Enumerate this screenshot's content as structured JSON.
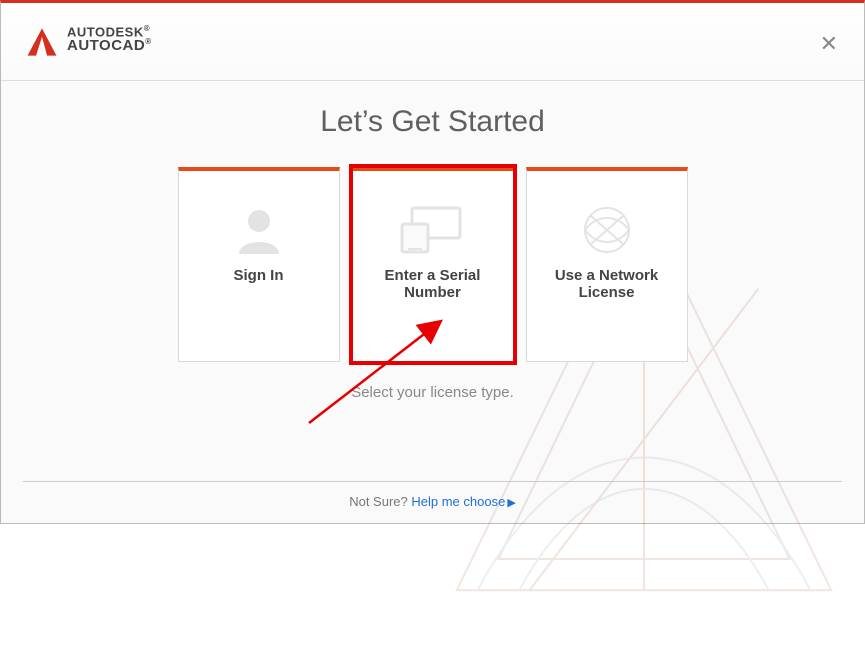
{
  "brand": {
    "line1": "AUTODESK",
    "line2": "AUTOCAD"
  },
  "title": "Let’s Get Started",
  "cards": {
    "signin": {
      "label": "Sign In"
    },
    "serial": {
      "label": "Enter a Serial Number"
    },
    "network": {
      "label": "Use a Network License"
    }
  },
  "hint": "Select your license type.",
  "footer": {
    "prefix": "Not Sure? ",
    "link": "Help me choose"
  },
  "colors": {
    "accent": "#e64a19",
    "highlight": "#e60000",
    "link": "#1e6fd6"
  }
}
